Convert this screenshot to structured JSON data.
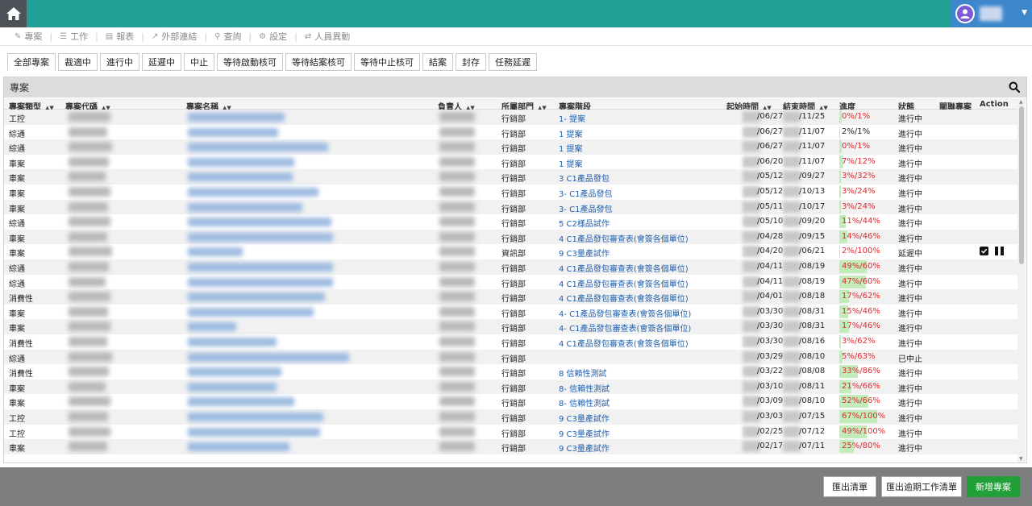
{
  "menu": [
    {
      "label": "專案",
      "icon": "pencil-icon"
    },
    {
      "label": "工作",
      "icon": "list-icon"
    },
    {
      "label": "報表",
      "icon": "chart-icon"
    },
    {
      "label": "外部連結",
      "icon": "external-link-icon"
    },
    {
      "label": "查詢",
      "icon": "search-icon"
    },
    {
      "label": "設定",
      "icon": "gear-icon"
    },
    {
      "label": "人員異動",
      "icon": "swap-icon"
    }
  ],
  "tabs": [
    "全部專案",
    "裁適中",
    "進行中",
    "延遲中",
    "中止",
    "等待啟動核可",
    "等待結案核可",
    "等待中止核可",
    "結案",
    "封存",
    "任務延遲"
  ],
  "active_tab": 0,
  "panel_title": "專案",
  "columns": {
    "type": "專案類型",
    "code": "專案代碼",
    "name": "專案名稱",
    "owner": "負責人",
    "dept": "所屬部門",
    "stage": "專案階段",
    "start": "起始時間",
    "end": "結束時間",
    "progress": "進度",
    "status": "狀態",
    "related": "關聯專案",
    "action": "Action"
  },
  "rows": [
    {
      "type": "工控",
      "dept": "行銷部",
      "stage": "1- 提案",
      "start": "/06/27",
      "end": "/11/25",
      "progress": "0%/1%",
      "p": 0,
      "red": true,
      "status": "進行中"
    },
    {
      "type": "綜通",
      "dept": "行銷部",
      "stage": "1 提案",
      "start": "/06/27",
      "end": "/11/07",
      "progress": "2%/1%",
      "p": 2,
      "red": false,
      "status": "進行中"
    },
    {
      "type": "綜通",
      "dept": "行銷部",
      "stage": "1 提案",
      "start": "/06/27",
      "end": "/11/07",
      "progress": "0%/1%",
      "p": 0,
      "red": true,
      "status": "進行中"
    },
    {
      "type": "車案",
      "dept": "行銷部",
      "stage": "1 提案",
      "start": "/06/20",
      "end": "/11/07",
      "progress": "7%/12%",
      "p": 7,
      "red": true,
      "status": "進行中"
    },
    {
      "type": "車案",
      "dept": "行銷部",
      "stage": "3 C1產品發包",
      "start": "/05/12",
      "end": "/09/27",
      "progress": "3%/32%",
      "p": 3,
      "red": true,
      "status": "進行中"
    },
    {
      "type": "車案",
      "dept": "行銷部",
      "stage": "3- C1產品發包",
      "start": "/05/12",
      "end": "/10/13",
      "progress": "3%/24%",
      "p": 3,
      "red": true,
      "status": "進行中"
    },
    {
      "type": "車案",
      "dept": "行銷部",
      "stage": "3- C1產品發包",
      "start": "/05/11",
      "end": "/10/17",
      "progress": "3%/24%",
      "p": 3,
      "red": true,
      "status": "進行中"
    },
    {
      "type": "綜通",
      "dept": "行銷部",
      "stage": "5 C2樣品試作",
      "start": "/05/10",
      "end": "/09/20",
      "progress": "11%/44%",
      "p": 11,
      "red": true,
      "status": "進行中"
    },
    {
      "type": "車案",
      "dept": "行銷部",
      "stage": "4 C1產品發包審查表(會簽各個單位)",
      "start": "/04/28",
      "end": "/09/15",
      "progress": "14%/46%",
      "p": 14,
      "red": true,
      "status": "進行中"
    },
    {
      "type": "車案",
      "dept": "資訊部",
      "stage": "9 C3量產試作",
      "start": "/04/20",
      "end": "/06/21",
      "progress": "2%/100%",
      "p": 2,
      "red": true,
      "status": "延遲中",
      "actions": true
    },
    {
      "type": "綜通",
      "dept": "行銷部",
      "stage": "4 C1產品發包審查表(會簽各個單位)",
      "start": "/04/11",
      "end": "/08/19",
      "progress": "49%/60%",
      "p": 49,
      "red": true,
      "status": "進行中"
    },
    {
      "type": "綜通",
      "dept": "行銷部",
      "stage": "4 C1產品發包審查表(會簽各個單位)",
      "start": "/04/11",
      "end": "/08/19",
      "progress": "47%/60%",
      "p": 47,
      "red": true,
      "status": "進行中"
    },
    {
      "type": "消費性",
      "dept": "行銷部",
      "stage": "4 C1產品發包審查表(會簽各個單位)",
      "start": "/04/01",
      "end": "/08/18",
      "progress": "17%/62%",
      "p": 17,
      "red": true,
      "status": "進行中"
    },
    {
      "type": "車案",
      "dept": "行銷部",
      "stage": "4- C1產品發包審查表(會簽各個單位)",
      "start": "/03/30",
      "end": "/08/31",
      "progress": "15%/46%",
      "p": 15,
      "red": true,
      "status": "進行中"
    },
    {
      "type": "車案",
      "dept": "行銷部",
      "stage": "4- C1產品發包審查表(會簽各個單位)",
      "start": "/03/30",
      "end": "/08/31",
      "progress": "17%/46%",
      "p": 17,
      "red": true,
      "status": "進行中"
    },
    {
      "type": "消費性",
      "dept": "行銷部",
      "stage": "4 C1產品發包審查表(會簽各個單位)",
      "start": "/03/30",
      "end": "/08/16",
      "progress": "3%/62%",
      "p": 3,
      "red": true,
      "status": "進行中"
    },
    {
      "type": "綜通",
      "dept": "行銷部",
      "stage": "",
      "start": "/03/29",
      "end": "/08/10",
      "progress": "5%/63%",
      "p": 5,
      "red": true,
      "status": "已中止"
    },
    {
      "type": "消費性",
      "dept": "行銷部",
      "stage": "8 信賴性測試",
      "start": "/03/22",
      "end": "/08/08",
      "progress": "33%/86%",
      "p": 33,
      "red": true,
      "status": "進行中"
    },
    {
      "type": "車案",
      "dept": "行銷部",
      "stage": "8- 信賴性測試",
      "start": "/03/10",
      "end": "/08/11",
      "progress": "21%/66%",
      "p": 21,
      "red": true,
      "status": "進行中"
    },
    {
      "type": "車案",
      "dept": "行銷部",
      "stage": "8- 信賴性測試",
      "start": "/03/09",
      "end": "/08/10",
      "progress": "52%/66%",
      "p": 52,
      "red": true,
      "status": "進行中"
    },
    {
      "type": "工控",
      "dept": "行銷部",
      "stage": "9 C3量產試作",
      "start": "/03/03",
      "end": "/07/15",
      "progress": "67%/100%",
      "p": 67,
      "red": true,
      "status": "進行中"
    },
    {
      "type": "工控",
      "dept": "行銷部",
      "stage": "9 C3量產試作",
      "start": "/02/25",
      "end": "/07/12",
      "progress": "49%/100%",
      "p": 49,
      "red": true,
      "status": "進行中"
    },
    {
      "type": "車案",
      "dept": "行銷部",
      "stage": "9 C3量產試作",
      "start": "/02/17",
      "end": "/07/11",
      "progress": "25%/80%",
      "p": 25,
      "red": true,
      "status": "進行中"
    }
  ],
  "footer": {
    "export_label": "匯出清單",
    "export_overdue_label": "匯出逾期工作清單",
    "new_project_label": "新增專案"
  },
  "colors": {
    "topbar": "#23a096",
    "progress_fill": "#c2ecb9",
    "progress_red": "#e0282e",
    "link": "#1e5fb0",
    "primary_button": "#21a038"
  }
}
